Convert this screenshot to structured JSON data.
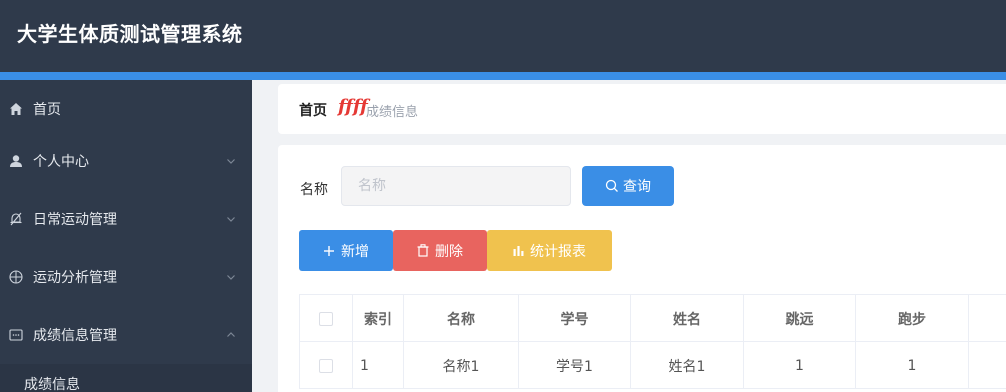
{
  "app": {
    "title": "大学生体质测试管理系统"
  },
  "colors": {
    "topbar": "#2f3a4b",
    "accent": "#3a8ee6",
    "danger": "#e8645f",
    "warning": "#f0c24e"
  },
  "sidebar": {
    "items": [
      {
        "label": "首页",
        "icon": "home-icon",
        "expandable": false
      },
      {
        "label": "个人中心",
        "icon": "user-icon",
        "expandable": true,
        "expanded": false
      },
      {
        "label": "日常运动管理",
        "icon": "bell-slash-icon",
        "expandable": true,
        "expanded": false
      },
      {
        "label": "运动分析管理",
        "icon": "compass-icon",
        "expandable": true,
        "expanded": false
      },
      {
        "label": "成绩信息管理",
        "icon": "message-icon",
        "expandable": true,
        "expanded": true
      }
    ],
    "subitems": [
      {
        "label": "成绩信息"
      }
    ]
  },
  "breadcrumb": {
    "home": "首页",
    "separator": "ffff",
    "current": "成绩信息"
  },
  "search": {
    "label": "名称",
    "placeholder": "名称",
    "value": "",
    "button": "查询"
  },
  "actions": {
    "add": "新增",
    "delete": "删除",
    "report": "统计报表"
  },
  "table": {
    "columns": [
      "",
      "索引",
      "名称",
      "学号",
      "姓名",
      "跳远",
      "跑步",
      ""
    ],
    "rows": [
      {
        "index": "1",
        "name": "名称1",
        "student_no": "学号1",
        "student_name": "姓名1",
        "long_jump": "1",
        "running": "1"
      }
    ]
  }
}
